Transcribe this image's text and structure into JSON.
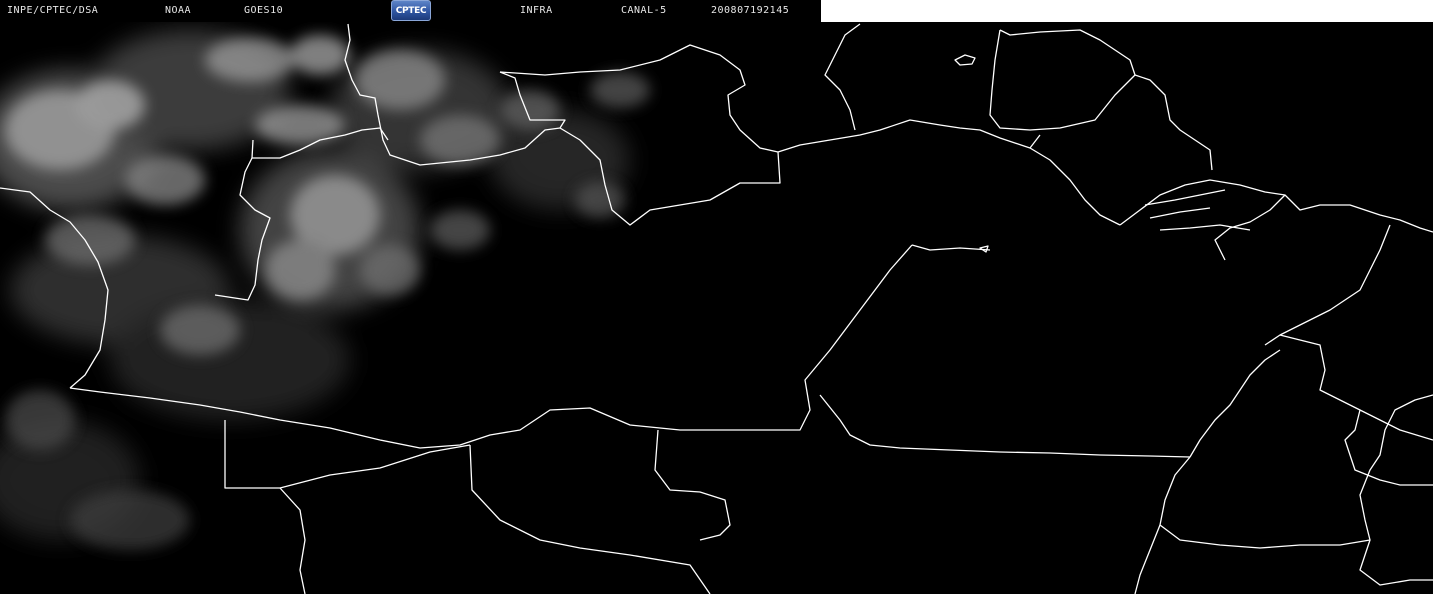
{
  "header": {
    "org": "INPE/CPTEC/DSA",
    "agency": "NOAA",
    "satellite": "GOES10",
    "logo_text": "CPTEC",
    "product": "INFRA",
    "channel": "CANAL-5",
    "timestamp": "200807192145"
  },
  "colors": {
    "background": "#000000",
    "header_text": "#e8e8e8",
    "border_lines": "#ffffff",
    "cloud_tone": "#9a9a9a",
    "logo_blue": "#2f56a3"
  }
}
